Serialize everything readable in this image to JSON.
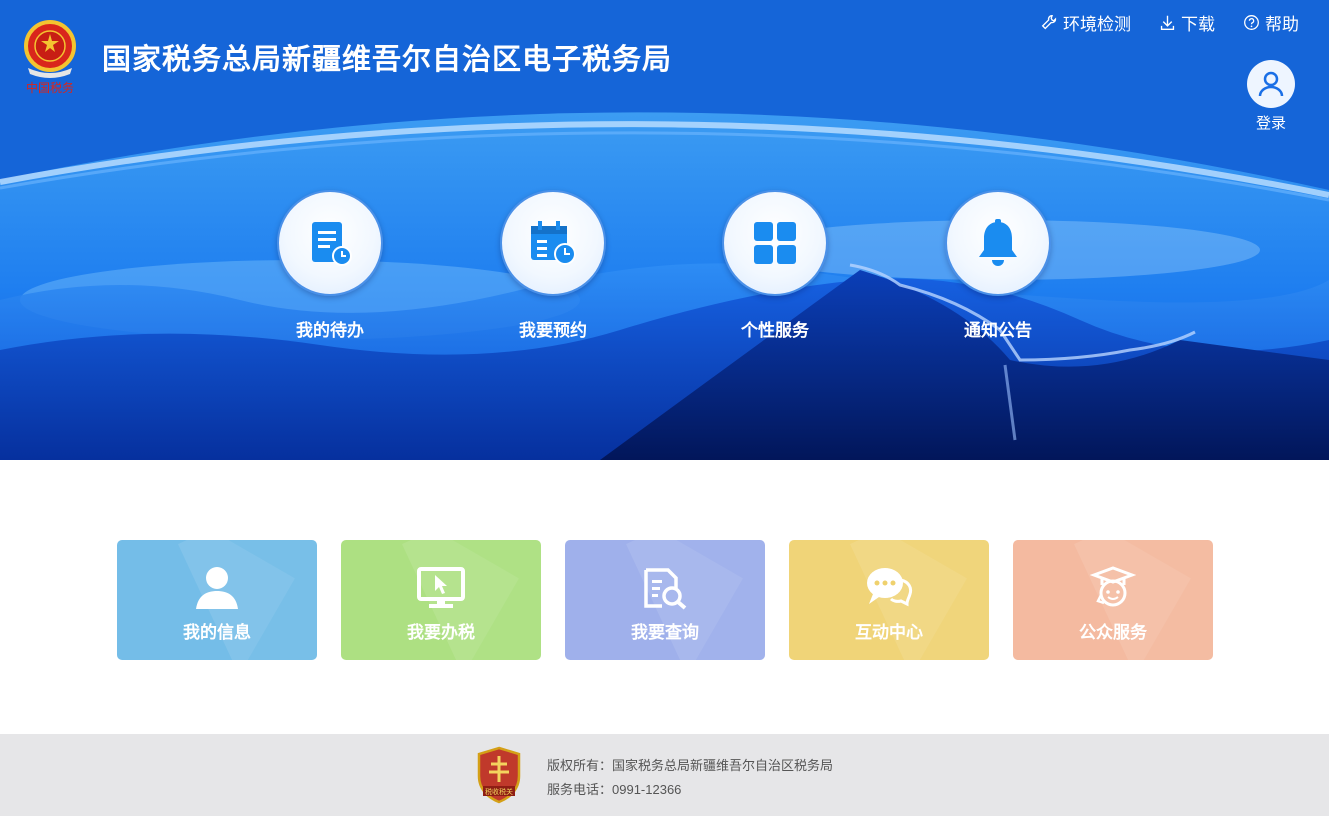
{
  "header": {
    "title": "国家税务总局新疆维吾尔自治区电子税务局",
    "emblem_text": "中国税务",
    "links": [
      {
        "label": "环境检测",
        "icon": "wrench-icon"
      },
      {
        "label": "下载",
        "icon": "download-icon"
      },
      {
        "label": "帮助",
        "icon": "help-circle-icon"
      }
    ],
    "login_label": "登录"
  },
  "hero_items": [
    {
      "label": "我的待办",
      "icon": "todo-document-clock-icon"
    },
    {
      "label": "我要预约",
      "icon": "calendar-clock-icon"
    },
    {
      "label": "个性服务",
      "icon": "grid-apps-icon"
    },
    {
      "label": "通知公告",
      "icon": "bell-icon"
    }
  ],
  "tiles": [
    {
      "label": "我的信息",
      "icon": "user-icon",
      "color": "#69b8e6"
    },
    {
      "label": "我要办税",
      "icon": "monitor-cursor-icon",
      "color": "#a6de78"
    },
    {
      "label": "我要查询",
      "icon": "document-search-icon",
      "color": "#97aaea"
    },
    {
      "label": "互动中心",
      "icon": "chat-bubbles-icon",
      "color": "#efd16d"
    },
    {
      "label": "公众服务",
      "icon": "graduate-service-icon",
      "color": "#f3b598"
    }
  ],
  "footer": {
    "badge_text": "税收税关",
    "copyright": "版权所有：国家税务总局新疆维吾尔自治区税务局",
    "phone": "服务电话：0991-12366"
  },
  "colors": {
    "header_blue": "#1565d8",
    "icon_blue": "#1a8cf0",
    "footer_bg": "#e6e6e8"
  }
}
